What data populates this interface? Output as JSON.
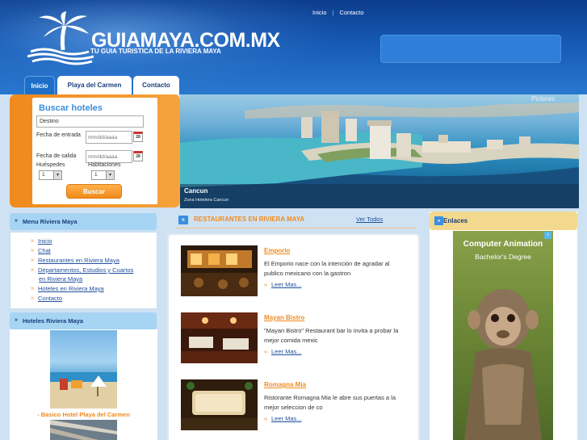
{
  "header": {
    "site_title": "GUIAMAYA.COM.MX",
    "site_subtitle": "TU GUIA TURISTICA DE LA RIVIERA MAYA",
    "top_links": [
      "Inicio",
      "Contacto"
    ],
    "top_links_separator": "|"
  },
  "tabs": [
    {
      "label": "Inicio",
      "active": true
    },
    {
      "label": "Playa del Carmen",
      "active": false
    },
    {
      "label": "Contacto",
      "active": false
    }
  ],
  "search": {
    "title": "Buscar hoteles",
    "destination_value": "Destino",
    "checkin_label": "Fecha de entrada",
    "checkout_label": "Fecha de salida",
    "date_placeholder": "mm/dd/aaaa",
    "calendar_day": "28",
    "guests_label": "Huéspedes",
    "rooms_label": "Habitaciones",
    "guests_value": "1",
    "rooms_value": "1",
    "button_label": "Buscar"
  },
  "hero": {
    "pictures_label": "Pictures",
    "caption_title": "Cancun",
    "caption_sub": "Zona Hotelera Cancun"
  },
  "menu": {
    "title": "Menu Riviera Maya",
    "items": [
      "Inicio",
      "Chat",
      "Restaurantes en Riviera Maya",
      "Departamentos, Estudios y Cuartos",
      "en Riviera Maya",
      "Hoteles en Riviera Maya",
      "Contacto"
    ]
  },
  "hotels": {
    "title": "Hoteles Riviera Maya",
    "featured_label": "- Basico Hotel Playa del Carmen"
  },
  "restaurants": {
    "section_title": "RESTAURANTES EN RIVIERA MAYA",
    "see_all": "Ver Todos",
    "items": [
      {
        "name": "Emporio",
        "desc_lines": [
          "El Emporio nace con la intención de agradar al",
          "publico mexicano con la gastron"
        ],
        "more": "Leer Mas..."
      },
      {
        "name": "Mayan Bistro",
        "desc_lines": [
          "\"Mayan Bistro\" Restaurant bar lo invita a probar la",
          "mejor comida mexic"
        ],
        "more": "Leer Mas..."
      },
      {
        "name": "Romagna Mia",
        "desc_lines": [
          "Ristorante Romagna Mia le abre sus puertas a la",
          "mejor seleccion de co"
        ],
        "more": "Leer Mas..."
      }
    ]
  },
  "links": {
    "title": "Enlaces",
    "ad_title": "Computer Animation",
    "ad_subtitle": "Bachelor's Degree"
  },
  "colors": {
    "header_blue": "#1659b4",
    "accent_orange": "#f08a1c",
    "link_blue": "#1f4f9c",
    "side_head_blue": "#a6d4f3",
    "enlaces_yellow": "#f2d98e"
  }
}
